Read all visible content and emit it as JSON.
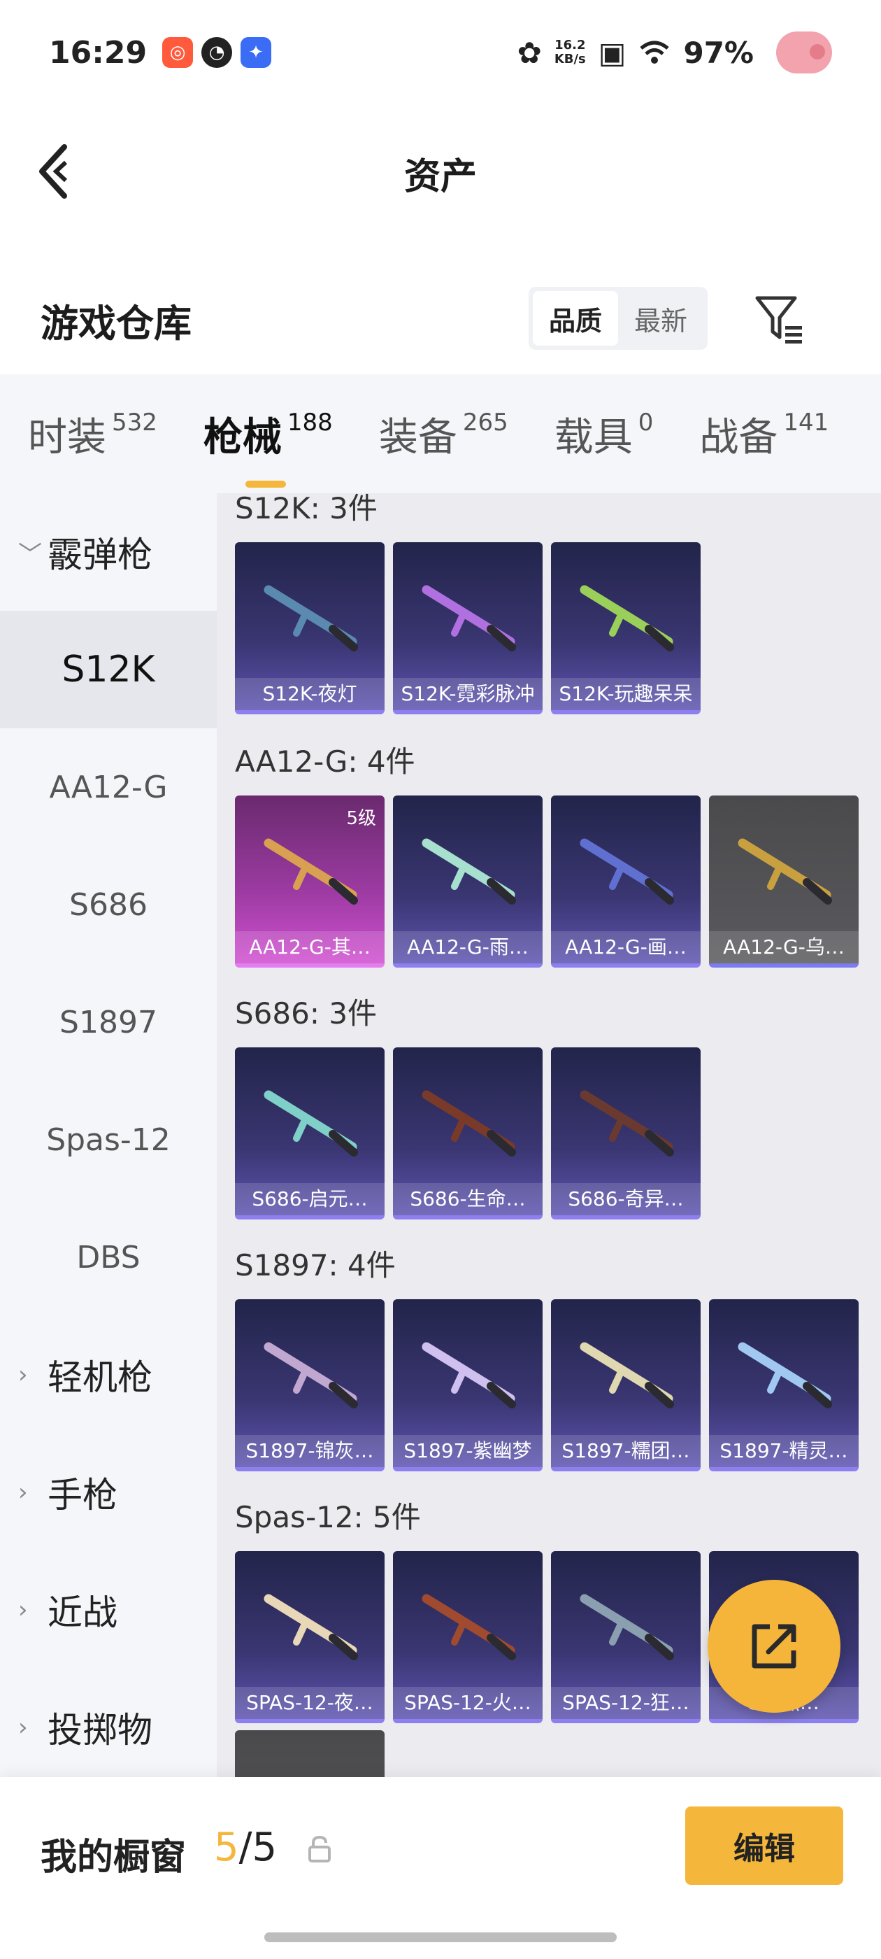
{
  "status_bar": {
    "time": "16:29",
    "net_speed_value": "16.2",
    "net_speed_unit": "KB/s",
    "battery": "97%"
  },
  "header": {
    "title": "资产"
  },
  "section": {
    "title": "游戏仓库",
    "sort_options": [
      "品质",
      "最新"
    ],
    "active_sort": "品质"
  },
  "tabs": [
    {
      "label": "时装",
      "count": "532"
    },
    {
      "label": "枪械",
      "count": "188"
    },
    {
      "label": "装备",
      "count": "265"
    },
    {
      "label": "载具",
      "count": "0"
    },
    {
      "label": "战备",
      "count": "141"
    }
  ],
  "sidebar": {
    "groups": [
      {
        "label": "霰弹枪",
        "expanded": true
      },
      {
        "label": "轻机枪"
      },
      {
        "label": "手枪"
      },
      {
        "label": "近战"
      },
      {
        "label": "投掷物"
      }
    ],
    "sub_items": [
      "S12K",
      "AA12-G",
      "S686",
      "S1897",
      "Spas-12",
      "DBS"
    ]
  },
  "groups": [
    {
      "title": "S12K: 3件",
      "items": [
        {
          "name": "S12K-夜灯",
          "color": "#5a8ab0"
        },
        {
          "name": "S12K-霓彩脉冲",
          "color": "#b070e0"
        },
        {
          "name": "S12K-玩趣呆呆",
          "color": "#9ad05a"
        }
      ]
    },
    {
      "title": "AA12-G: 4件",
      "items": [
        {
          "name": "AA12-G-其…",
          "color": "#d8a050",
          "level": "5级"
        },
        {
          "name": "AA12-G-雨…",
          "color": "#a8e0d0"
        },
        {
          "name": "AA12-G-画…",
          "color": "#6070d0"
        },
        {
          "name": "AA12-G-乌…",
          "color": "#c8a040"
        }
      ]
    },
    {
      "title": "S686: 3件",
      "items": [
        {
          "name": "S686-启元…",
          "color": "#7fd0c8"
        },
        {
          "name": "S686-生命…",
          "color": "#7a3a2a"
        },
        {
          "name": "S686-奇异…",
          "color": "#6a3a30"
        }
      ]
    },
    {
      "title": "S1897: 4件",
      "items": [
        {
          "name": "S1897-锦灰…",
          "color": "#c0a8d0"
        },
        {
          "name": "S1897-紫幽梦",
          "color": "#d0c0f0"
        },
        {
          "name": "S1897-糯团…",
          "color": "#e0d8b0"
        },
        {
          "name": "S1897-精灵…",
          "color": "#a0c8f0"
        }
      ]
    },
    {
      "title": "Spas-12: 5件",
      "items": [
        {
          "name": "SPAS-12-夜…",
          "color": "#e8d8b8"
        },
        {
          "name": "SPAS-12-火…",
          "color": "#a04a30"
        },
        {
          "name": "SPAS-12-狂…",
          "color": "#8aa0b0"
        },
        {
          "name": "S…燕…",
          "color": "#d0c0a0"
        }
      ]
    }
  ],
  "bottom": {
    "showcase_label": "我的橱窗",
    "count_current": "5",
    "count_total": "/5",
    "edit_label": "编辑"
  }
}
